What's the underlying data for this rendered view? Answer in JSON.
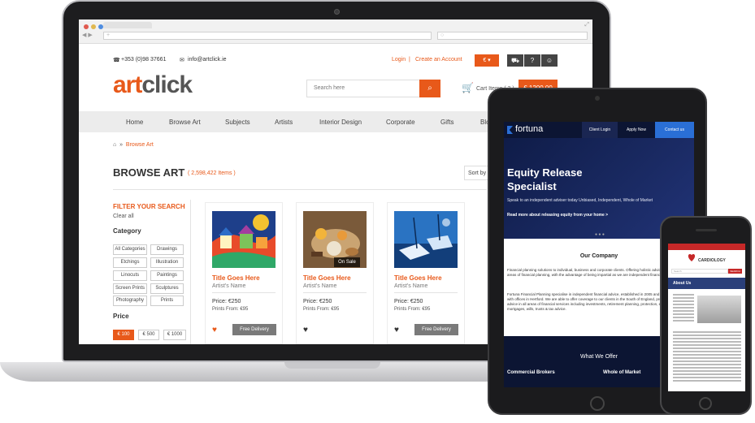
{
  "laptop": {
    "topbar": {
      "phone": "+353 (0)98 37661",
      "email": "info@artclick.ie",
      "login": "Login",
      "separator": "|",
      "create_account": "Create an Account",
      "currency": "€ ▾",
      "help": "?"
    },
    "logo": {
      "art": "art",
      "click": "click"
    },
    "search": {
      "placeholder": "Search here"
    },
    "cart": {
      "label": "Cart Items ( 2 )",
      "total": "€ 1200.00"
    },
    "nav": [
      "Home",
      "Browse Art",
      "Subjects",
      "Artists",
      "Interior Design",
      "Corporate",
      "Gifts",
      "Blo"
    ],
    "breadcrumb": {
      "current": "Browse Art"
    },
    "heading": {
      "title": "BROWSE ART",
      "count": "( 2,598,422 Items )",
      "sort": "Sort by"
    },
    "filter": {
      "title": "FILTER YOUR SEARCH",
      "clear": "Clear all",
      "category_label": "Category",
      "categories": [
        "All Categories",
        "Drawings",
        "Etchings",
        "Illustration",
        "Linocuts",
        "Paintings",
        "Screen Prints",
        "Sculptures",
        "Photography",
        "Prints"
      ],
      "price_label": "Price",
      "prices": [
        "€ 100",
        "€ 500",
        "€ 1000"
      ]
    },
    "products": [
      {
        "title": "Title Goes Here",
        "artist": "Artist's Name",
        "price": "Price: €250",
        "prints": "Prints From: €95",
        "delivery": "Free Delivery",
        "badge": ""
      },
      {
        "title": "Title Goes Here",
        "artist": "Artist's Name",
        "price": "Price: €250",
        "prints": "Prints From: €95",
        "delivery": "",
        "badge": "On Sale"
      },
      {
        "title": "Title Goes Here",
        "artist": "Artist's Name",
        "price": "Price: €250",
        "prints": "Prints From: €95",
        "delivery": "Free Delivery",
        "badge": ""
      }
    ]
  },
  "tablet": {
    "brand": "fortuna",
    "header_buttons": [
      "Client Login",
      "Apply Now",
      "Contact us"
    ],
    "hero": {
      "title_line1": "Equity Release",
      "title_line2": "Specialist",
      "subtitle": "Speak to an independent adviser today Unbiased, Independent, Whole of Market",
      "link": "Read more about releasing equity from your home >"
    },
    "company": {
      "title": "Our Company",
      "para1": "Financial planning solutions to individual, business and corporate clients. Offering holistic advice that covers all areas of financial planning, with the advantage of being impartial as we are independent financial advisers.",
      "para2": "Fortuna Financial Planning specialise in independent financial advice, established in 2005 and based in London with offices in Hertford. We are able to offer coverage to our clients in the South of England, providing financial advice in all areas of financial services including investments, retirement planning, protection, estate planning, mortgages, wills, trusts & tax advice.",
      "link_investments": "investments",
      "link_mortgages": "mortgages"
    },
    "offer": {
      "title": "What We Offer",
      "item_a": "Commercial Brokers",
      "item_b": "Whole of Market"
    }
  },
  "phone": {
    "logo_text": "CARDIOLOGY",
    "search_placeholder": "Search",
    "search_button": "SEARCH",
    "section": "About Us"
  },
  "colors": {
    "artclick_orange": "#e8591a",
    "fortuna_navy": "#0c1533",
    "fortuna_blue": "#2a6fd6",
    "cardiology_red": "#c62828"
  }
}
